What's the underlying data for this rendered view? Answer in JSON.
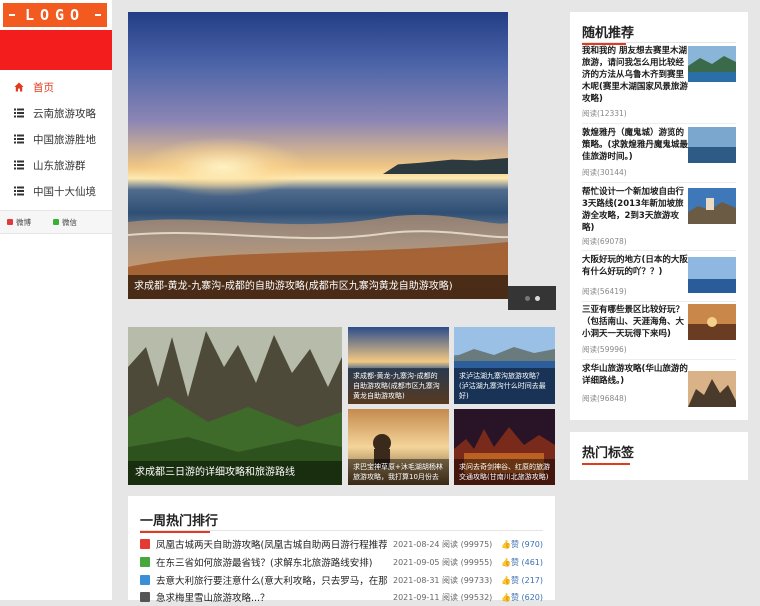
{
  "logo": "LOGO",
  "sidebar": {
    "items": [
      {
        "label": "首页",
        "icon": "home-icon",
        "active": true
      },
      {
        "label": "云南旅游攻略",
        "icon": "list-icon",
        "active": false
      },
      {
        "label": "中国旅游胜地",
        "icon": "list-icon",
        "active": false
      },
      {
        "label": "山东旅游群",
        "icon": "list-icon",
        "active": false
      },
      {
        "label": "中国十大仙境",
        "icon": "list-icon",
        "active": false
      }
    ],
    "social": [
      {
        "label": "微博",
        "color": "#e0393e"
      },
      {
        "label": "微信",
        "color": "#3cb034"
      }
    ]
  },
  "hero": {
    "caption": "求成都-黄龙-九寨沟-成都的自助游攻略(成都市区九寨沟黄龙自助游攻略)"
  },
  "grid": {
    "big": "求成都三日游的详细攻略和旅游路线",
    "small": [
      "求成都-黄龙-九寨沟-成都的自助游攻略(成都市区九寨沟黄龙自助游攻略)",
      "求泸沽湖九寨沟旅游攻略？(泸沽湖九寨沟什么时间去最好)",
      "求巴宝神草原+沐毛湖胡杨林旅游攻略，我打算10月份去",
      "求问去奇剑神谷、红原的旅游交通攻略(甘南川北旅游攻略)"
    ]
  },
  "weekly": {
    "title": "一周热门排行",
    "rows": [
      {
        "title": "凤凰古城两天自助游攻略(凤凰古城自助两日游行程推荐)",
        "date": "2021-08-24",
        "read": "阅读 (99975)",
        "like": "赞 (970)",
        "flag": "#e53a34"
      },
      {
        "title": "在东三省如何旅游最省钱？(求解东北旅游路线安排)",
        "date": "2021-09-05",
        "read": "阅读 (99955)",
        "like": "赞 (461)",
        "flag": "#46a83c"
      },
      {
        "title": "去意大利旅行要注意什么(意大利攻略，只去罗马，在那边果两天的)",
        "date": "2021-08-31",
        "read": "阅读 (99733)",
        "like": "赞 (217)",
        "flag": "#3a8fd6"
      },
      {
        "title": "急求梅里雪山旅游攻略...？",
        "date": "2021-09-11",
        "read": "阅读 (99532)",
        "like": "赞 (620)",
        "flag": "#555555"
      }
    ]
  },
  "random": {
    "title": "随机推荐",
    "items": [
      {
        "title": "我和我的 朋友想去赛里木湖旅游，请问我怎么用比较经济的方法从乌鲁木齐到赛里木呢(赛里木湖国家风景旅游攻略)",
        "read": "阅读(12331)"
      },
      {
        "title": "敦煌雅丹（魔鬼城）游览的策略。(求敦煌雅丹魔鬼城最佳旅游时间。)",
        "read": "阅读(30144)"
      },
      {
        "title": "帮忙设计一个新加坡自由行3天路线(2013年新加坡旅游全攻略，2到3天旅游攻略)",
        "read": "阅读(69078)"
      },
      {
        "title": "大阪好玩的地方(日本的大阪有什么好玩的吖？？)",
        "read": "阅读(56419)"
      },
      {
        "title": "三亚有哪些景区比较好玩？（包括南山、天涯海角、大小洞天一天玩得下来吗)",
        "read": "阅读(59996)"
      },
      {
        "title": "求华山旅游攻略(华山旅游的详细路线。)",
        "read": "阅读(96848)"
      }
    ]
  },
  "hot_tags": {
    "title": "热门标签"
  }
}
